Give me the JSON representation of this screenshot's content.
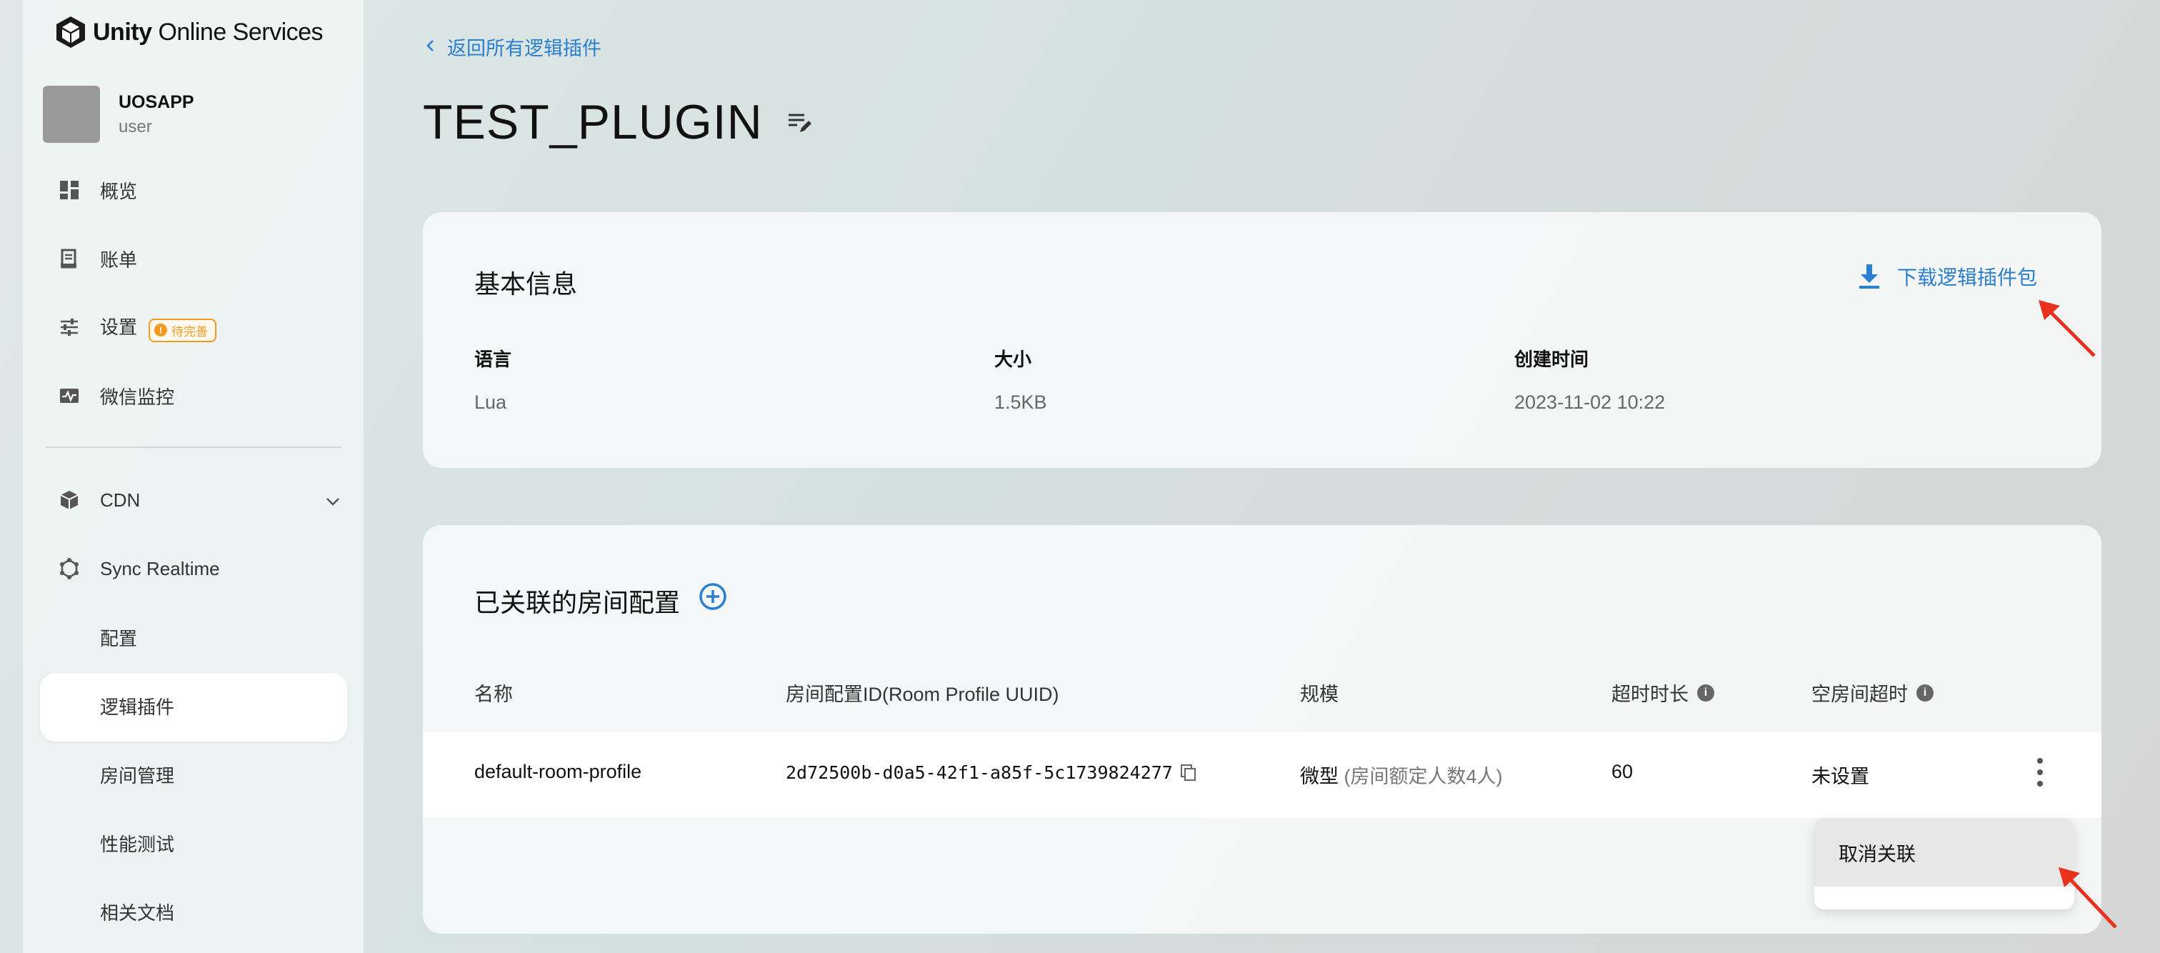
{
  "brand": {
    "bold": "Unity",
    "rest": " Online Services"
  },
  "account": {
    "name": "UOSAPP",
    "role": "user"
  },
  "nav": {
    "overview": "概览",
    "billing": "账单",
    "settings": "设置",
    "settings_badge": "待完善",
    "wechat": "微信监控",
    "cdn": "CDN",
    "sync": "Sync Realtime",
    "sub": {
      "config": "配置",
      "plugins": "逻辑插件",
      "rooms": "房间管理",
      "perf": "性能测试",
      "docs": "相关文档"
    }
  },
  "back_link": "返回所有逻辑插件",
  "page_title": "TEST_PLUGIN",
  "basic": {
    "title": "基本信息",
    "download": "下载逻辑插件包",
    "fields": [
      {
        "label": "语言",
        "value": "Lua"
      },
      {
        "label": "大小",
        "value": "1.5KB"
      },
      {
        "label": "创建时间",
        "value": "2023-11-02 10:22"
      }
    ]
  },
  "linked": {
    "title": "已关联的房间配置",
    "headers": [
      "名称",
      "房间配置ID(Room Profile UUID)",
      "规模",
      "超时时长",
      "空房间超时"
    ],
    "row": {
      "name": "default-room-profile",
      "uuid": "2d72500b-d0a5-42f1-a85f-5c1739824277",
      "scale": "微型",
      "scale_note": "(房间额定人数4人)",
      "timeout": "60",
      "empty_timeout": "未设置"
    },
    "menu": {
      "unlink": "取消关联"
    }
  },
  "colors": {
    "accent": "#2a7fd1",
    "warning": "#f29b1f",
    "annotation": "#e8321e"
  }
}
